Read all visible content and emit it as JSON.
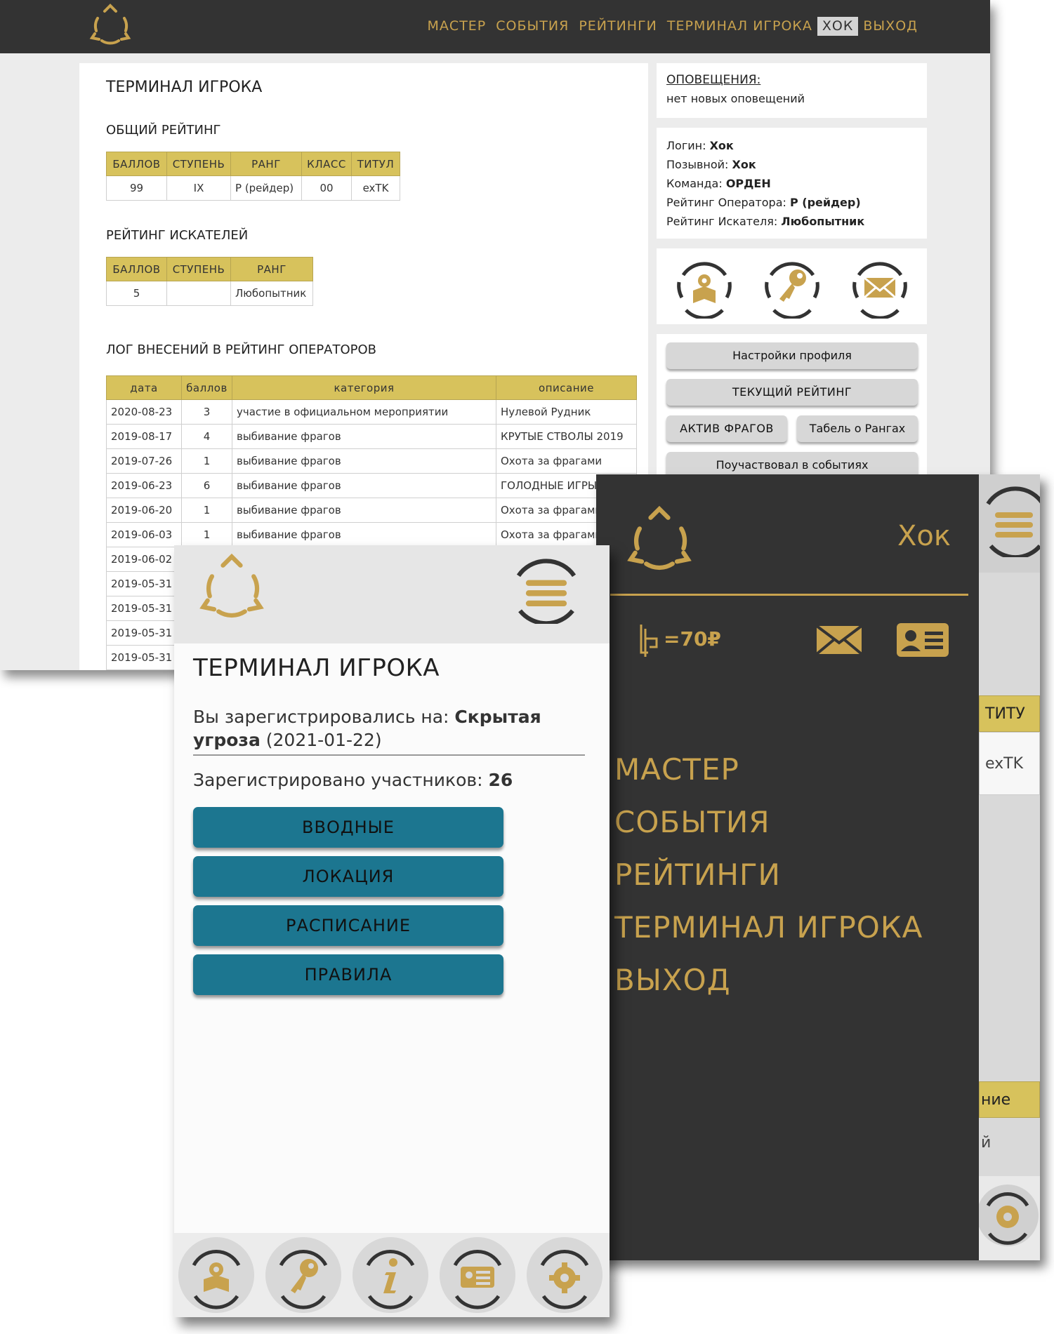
{
  "desktop": {
    "nav": [
      "МАСТЕР",
      "СОБЫТИЯ",
      "РЕЙТИНГИ",
      "ТЕРМИНАЛ ИГРОКА",
      "ХОК",
      "ВЫХОД"
    ],
    "page_title": "ТЕРМИНАЛ ИГРОКА",
    "general": {
      "heading": "ОБЩИЙ РЕЙТИНГ",
      "headers": [
        "БАЛЛОВ",
        "СТУПЕНЬ",
        "РАНГ",
        "КЛАСС",
        "ТИТУЛ"
      ],
      "row": [
        "99",
        "IX",
        "Р (рейдер)",
        "00",
        "exTK"
      ]
    },
    "seekers": {
      "heading": "РЕЙТИНГ ИСКАТЕЛЕЙ",
      "headers": [
        "БАЛЛОВ",
        "СТУПЕНЬ",
        "РАНГ"
      ],
      "row": [
        "5",
        "",
        "Любопытник"
      ]
    },
    "log": {
      "heading": "ЛОГ ВНЕСЕНИЙ В РЕЙТИНГ ОПЕРАТОРОВ",
      "headers": [
        "дата",
        "баллов",
        "категория",
        "описание"
      ],
      "rows": [
        [
          "2020-08-23",
          "3",
          "участие в официальном мероприятии",
          "Нулевой Рудник"
        ],
        [
          "2019-08-17",
          "4",
          "выбивание фрагов",
          "КРУТЫЕ СТВОЛЫ 2019"
        ],
        [
          "2019-07-26",
          "1",
          "выбивание фрагов",
          "Охота за фрагами"
        ],
        [
          "2019-06-23",
          "6",
          "выбивание фрагов",
          "ГОЛОДНЫЕ ИГРЫ"
        ],
        [
          "2019-06-20",
          "1",
          "выбивание фрагов",
          "Охота за фрагами"
        ],
        [
          "2019-06-03",
          "1",
          "выбивание фрагов",
          "Охота за фрагами"
        ],
        [
          "2019-06-02",
          "",
          "",
          ""
        ],
        [
          "2019-05-31",
          "",
          "",
          ""
        ],
        [
          "2019-05-31",
          "",
          "",
          ""
        ],
        [
          "2019-05-31",
          "",
          "",
          ""
        ],
        [
          "2019-05-31",
          "",
          "",
          ""
        ]
      ]
    },
    "notifications": {
      "title": "ОПОВЕЩЕНИЯ:",
      "text": "нет новых оповещений"
    },
    "profile": [
      {
        "label": "Логин: ",
        "value": "Хок"
      },
      {
        "label": "Позывной: ",
        "value": "Хок"
      },
      {
        "label": "Команда: ",
        "value": "ОРДЕН"
      },
      {
        "label": "Рейтинг Оператора: ",
        "value": "Р (рейдер)"
      },
      {
        "label": "Рейтинг Искателя: ",
        "value": "Любопытник"
      }
    ],
    "buttons": {
      "profile_settings": "Настройки профиля",
      "current_rating": "ТЕКУЩИЙ РЕЙТИНГ",
      "frag_assets": "АКТИВ ФРАГОВ",
      "rank_table": "Табель о Рангах",
      "participated": "Поучаствовал в событиях"
    }
  },
  "mobile1": {
    "title": "ТЕРМИНАЛ ИГРОКА",
    "reg_prefix": "Вы зарегистрировались на: ",
    "reg_event": "Скрытая угроза",
    "reg_date": " (2021-01-22)",
    "count_label": "Зарегистрировано участников: ",
    "count_value": "26",
    "buttons": [
      "ВВОДНЫЕ",
      "ЛОКАЦИЯ",
      "РАСПИСАНИЕ",
      "ПРАВИЛА"
    ]
  },
  "mobile2": {
    "username": "Хок",
    "balance": "=70₽",
    "menu": [
      "МАСТЕР",
      "СОБЫТИЯ",
      "РЕЙТИНГИ",
      "ТЕРМИНАЛ ИГРОКА",
      "ВЫХОД"
    ],
    "bg_header": "ТИТУ",
    "bg_cell": "exTK",
    "bg_header2": "ние",
    "bg_cell2": "й"
  },
  "colors": {
    "gold": "#c8a24e",
    "dark": "#333333",
    "teal": "#1c7690",
    "table_header": "#d7c25c"
  }
}
